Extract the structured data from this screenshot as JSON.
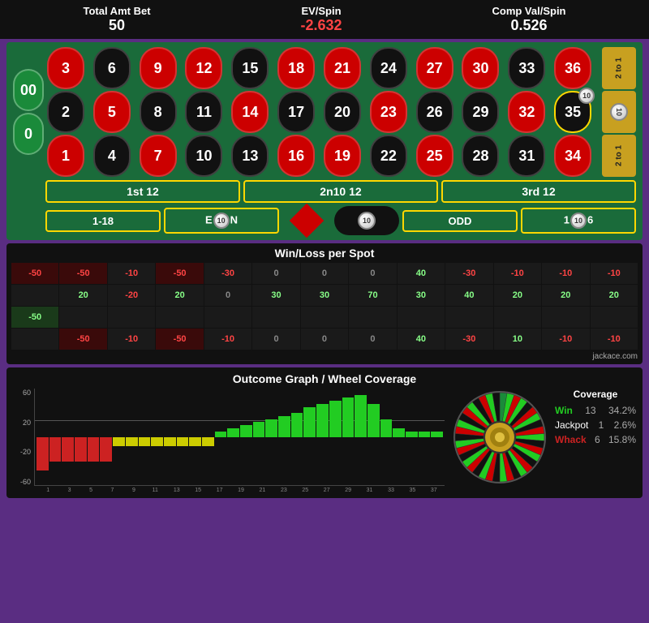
{
  "header": {
    "total_amt_bet_label": "Total Amt Bet",
    "total_amt_bet_value": "50",
    "ev_spin_label": "EV/Spin",
    "ev_spin_value": "-2.632",
    "comp_val_spin_label": "Comp Val/Spin",
    "comp_val_spin_value": "0.526"
  },
  "roulette": {
    "numbers": [
      {
        "num": "3",
        "color": "red",
        "row": 0,
        "col": 0
      },
      {
        "num": "6",
        "color": "black",
        "row": 0,
        "col": 1
      },
      {
        "num": "9",
        "color": "red",
        "row": 0,
        "col": 2
      },
      {
        "num": "12",
        "color": "red",
        "row": 0,
        "col": 3
      },
      {
        "num": "15",
        "color": "black",
        "row": 0,
        "col": 4
      },
      {
        "num": "18",
        "color": "red",
        "row": 0,
        "col": 5
      },
      {
        "num": "21",
        "color": "red",
        "row": 0,
        "col": 6
      },
      {
        "num": "24",
        "color": "black",
        "row": 0,
        "col": 7
      },
      {
        "num": "27",
        "color": "red",
        "row": 0,
        "col": 8
      },
      {
        "num": "30",
        "color": "red",
        "row": 0,
        "col": 9
      },
      {
        "num": "33",
        "color": "black",
        "row": 0,
        "col": 10
      },
      {
        "num": "36",
        "color": "red",
        "row": 0,
        "col": 11
      },
      {
        "num": "2",
        "color": "black",
        "row": 1,
        "col": 0
      },
      {
        "num": "5",
        "color": "red",
        "row": 1,
        "col": 1
      },
      {
        "num": "8",
        "color": "black",
        "row": 1,
        "col": 2
      },
      {
        "num": "11",
        "color": "black",
        "row": 1,
        "col": 3
      },
      {
        "num": "14",
        "color": "red",
        "row": 1,
        "col": 4
      },
      {
        "num": "17",
        "color": "black",
        "row": 1,
        "col": 5
      },
      {
        "num": "20",
        "color": "black",
        "row": 1,
        "col": 6
      },
      {
        "num": "23",
        "color": "red",
        "row": 1,
        "col": 7
      },
      {
        "num": "26",
        "color": "black",
        "row": 1,
        "col": 8
      },
      {
        "num": "29",
        "color": "black",
        "row": 1,
        "col": 9
      },
      {
        "num": "32",
        "color": "red",
        "row": 1,
        "col": 10
      },
      {
        "num": "35",
        "color": "black",
        "row": 1,
        "col": 11
      },
      {
        "num": "1",
        "color": "red",
        "row": 2,
        "col": 0
      },
      {
        "num": "4",
        "color": "black",
        "row": 2,
        "col": 1
      },
      {
        "num": "7",
        "color": "red",
        "row": 2,
        "col": 2
      },
      {
        "num": "10",
        "color": "black",
        "row": 2,
        "col": 3
      },
      {
        "num": "13",
        "color": "black",
        "row": 2,
        "col": 4
      },
      {
        "num": "16",
        "color": "red",
        "row": 2,
        "col": 5
      },
      {
        "num": "19",
        "color": "red",
        "row": 2,
        "col": 6
      },
      {
        "num": "22",
        "color": "black",
        "row": 2,
        "col": 7
      },
      {
        "num": "25",
        "color": "red",
        "row": 2,
        "col": 8
      },
      {
        "num": "28",
        "color": "black",
        "row": 2,
        "col": 9
      },
      {
        "num": "31",
        "color": "black",
        "row": 2,
        "col": 10
      },
      {
        "num": "34",
        "color": "red",
        "row": 2,
        "col": 11
      }
    ],
    "zeros": [
      "00",
      "0"
    ],
    "dozens": [
      "1st 12",
      "2nd 12",
      "3rd 12"
    ],
    "bottom_labels": [
      "1-18",
      "EVEN",
      "",
      "10",
      "ODD",
      "19-36"
    ],
    "payouts": [
      "2 to 1",
      "2 to 1",
      "2 to 1"
    ]
  },
  "win_loss": {
    "title": "Win/Loss per Spot",
    "rows": [
      [
        "-50",
        "-50",
        "-10",
        "-50",
        "-30",
        "0",
        "0",
        "0",
        "40",
        "-30",
        "-10",
        "-10",
        "-10"
      ],
      [
        "",
        "20",
        "-20",
        "20",
        "0",
        "30",
        "30",
        "70",
        "30",
        "40",
        "20",
        "20",
        "20"
      ],
      [
        "-50",
        "",
        "",
        "",
        "",
        "",
        "",
        "",
        "",
        "",
        "",
        "",
        ""
      ],
      [
        "",
        "-50",
        "-10",
        "-50",
        "-10",
        "0",
        "0",
        "0",
        "40",
        "-30",
        "10",
        "-10",
        "-10"
      ]
    ]
  },
  "graph": {
    "title": "Outcome Graph / Wheel Coverage",
    "y_labels": [
      "60",
      "20",
      "-20",
      "-60"
    ],
    "x_labels": [
      "1",
      "3",
      "5",
      "7",
      "9",
      "11",
      "13",
      "15",
      "17",
      "19",
      "21",
      "23",
      "25",
      "27",
      "29",
      "31",
      "33",
      "35",
      "37"
    ],
    "bars": [
      {
        "val": -55,
        "type": "red"
      },
      {
        "val": -40,
        "type": "red"
      },
      {
        "val": -40,
        "type": "red"
      },
      {
        "val": -40,
        "type": "red"
      },
      {
        "val": -40,
        "type": "red"
      },
      {
        "val": -40,
        "type": "red"
      },
      {
        "val": -15,
        "type": "yellow"
      },
      {
        "val": -15,
        "type": "yellow"
      },
      {
        "val": -15,
        "type": "yellow"
      },
      {
        "val": -15,
        "type": "yellow"
      },
      {
        "val": -15,
        "type": "yellow"
      },
      {
        "val": -15,
        "type": "yellow"
      },
      {
        "val": -15,
        "type": "yellow"
      },
      {
        "val": -15,
        "type": "yellow"
      },
      {
        "val": 10,
        "type": "green"
      },
      {
        "val": 15,
        "type": "green"
      },
      {
        "val": 20,
        "type": "green"
      },
      {
        "val": 25,
        "type": "green"
      },
      {
        "val": 30,
        "type": "green"
      },
      {
        "val": 35,
        "type": "green"
      },
      {
        "val": 40,
        "type": "green"
      },
      {
        "val": 50,
        "type": "green"
      },
      {
        "val": 55,
        "type": "green"
      },
      {
        "val": 60,
        "type": "green"
      },
      {
        "val": 65,
        "type": "green"
      },
      {
        "val": 70,
        "type": "green"
      },
      {
        "val": 55,
        "type": "green"
      },
      {
        "val": 30,
        "type": "green"
      },
      {
        "val": 15,
        "type": "green"
      },
      {
        "val": 10,
        "type": "green"
      },
      {
        "val": 10,
        "type": "green"
      },
      {
        "val": 10,
        "type": "green"
      }
    ],
    "coverage": {
      "title": "Coverage",
      "win_label": "Win",
      "win_count": "13",
      "win_pct": "34.2%",
      "jackpot_label": "Jackpot",
      "jackpot_count": "1",
      "jackpot_pct": "2.6%",
      "whack_label": "Whack",
      "whack_count": "6",
      "whack_pct": "15.8%"
    }
  },
  "attribution": "jackace.com"
}
